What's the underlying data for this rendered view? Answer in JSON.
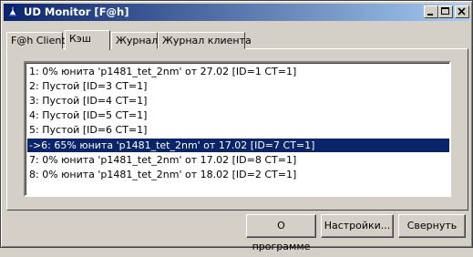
{
  "window": {
    "title": "UD Monitor [F@h]",
    "accent": "#0a246a"
  },
  "tabs": [
    {
      "label": "F@h Client",
      "active": false
    },
    {
      "label": "Кэш",
      "active": true
    },
    {
      "label": "Журнал",
      "active": false
    },
    {
      "label": "Журнал клиента",
      "active": false
    }
  ],
  "cache_list": {
    "items": [
      {
        "text": "1: 0% юнита 'p1481_tet_2nm' от 27.02 [ID=1 CT=1]",
        "selected": false
      },
      {
        "text": "2: Пустой [ID=3 CT=1]",
        "selected": false
      },
      {
        "text": "3: Пустой [ID=4 CT=1]",
        "selected": false
      },
      {
        "text": "4: Пустой [ID=5 CT=1]",
        "selected": false
      },
      {
        "text": "5: Пустой [ID=6 CT=1]",
        "selected": false
      },
      {
        "text": "->6: 65% юнита 'p1481_tet_2nm' от 17.02 [ID=7 CT=1]",
        "selected": true
      },
      {
        "text": "7: 0% юнита 'p1481_tet_2nm' от 17.02 [ID=8 CT=1]",
        "selected": false
      },
      {
        "text": "8: 0% юнита 'p1481_tet_2nm' от 18.02 [ID=2 CT=1]",
        "selected": false
      }
    ]
  },
  "buttons": {
    "about": "О программе",
    "settings": "Настройки...",
    "minimize": "Свернуть"
  }
}
